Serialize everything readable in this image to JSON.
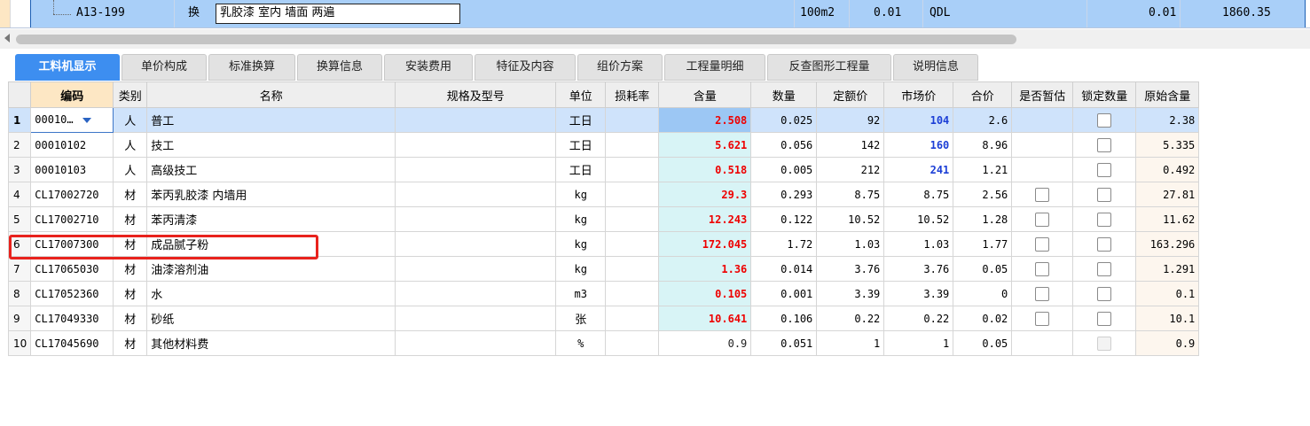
{
  "top_row": {
    "code": "A13-199",
    "type": "换",
    "name": "乳胶漆 室内 墙面 两遍",
    "unit": "100m2",
    "qty": "0.01",
    "expr": "QDL",
    "qty2": "0.01",
    "price": "1860.35"
  },
  "tabs": [
    "工料机显示",
    "单价构成",
    "标准换算",
    "换算信息",
    "安装费用",
    "特征及内容",
    "组价方案",
    "工程量明细",
    "反查图形工程量",
    "说明信息"
  ],
  "columns": {
    "code": "编码",
    "type": "类别",
    "name": "名称",
    "spec": "规格及型号",
    "unit": "单位",
    "loss": "损耗率",
    "content": "含量",
    "qty": "数量",
    "quota": "定额价",
    "market": "市场价",
    "total": "合价",
    "estimate": "是否暂估",
    "lock": "锁定数量",
    "orig": "原始含量"
  },
  "rows": [
    {
      "no": "1",
      "code": "00010…",
      "type": "人",
      "name": "普工",
      "unit": "工日",
      "content": "2.508",
      "qty": "0.025",
      "quota": "92",
      "market": "104",
      "total": "2.6",
      "orig": "2.38"
    },
    {
      "no": "2",
      "code": "00010102",
      "type": "人",
      "name": "技工",
      "unit": "工日",
      "content": "5.621",
      "qty": "0.056",
      "quota": "142",
      "market": "160",
      "total": "8.96",
      "orig": "5.335"
    },
    {
      "no": "3",
      "code": "00010103",
      "type": "人",
      "name": "高级技工",
      "unit": "工日",
      "content": "0.518",
      "qty": "0.005",
      "quota": "212",
      "market": "241",
      "total": "1.21",
      "orig": "0.492"
    },
    {
      "no": "4",
      "code": "CL17002720",
      "type": "材",
      "name": "苯丙乳胶漆 内墙用",
      "unit": "kg",
      "content": "29.3",
      "qty": "0.293",
      "quota": "8.75",
      "market": "8.75",
      "total": "2.56",
      "orig": "27.81"
    },
    {
      "no": "5",
      "code": "CL17002710",
      "type": "材",
      "name": "苯丙清漆",
      "unit": "kg",
      "content": "12.243",
      "qty": "0.122",
      "quota": "10.52",
      "market": "10.52",
      "total": "1.28",
      "orig": "11.62"
    },
    {
      "no": "6",
      "code": "CL17007300",
      "type": "材",
      "name": "成品腻子粉",
      "unit": "kg",
      "content": "172.045",
      "qty": "1.72",
      "quota": "1.03",
      "market": "1.03",
      "total": "1.77",
      "orig": "163.296"
    },
    {
      "no": "7",
      "code": "CL17065030",
      "type": "材",
      "name": "油漆溶剂油",
      "unit": "kg",
      "content": "1.36",
      "qty": "0.014",
      "quota": "3.76",
      "market": "3.76",
      "total": "0.05",
      "orig": "1.291"
    },
    {
      "no": "8",
      "code": "CL17052360",
      "type": "材",
      "name": "水",
      "unit": "m3",
      "content": "0.105",
      "qty": "0.001",
      "quota": "3.39",
      "market": "3.39",
      "total": "0",
      "orig": "0.1"
    },
    {
      "no": "9",
      "code": "CL17049330",
      "type": "材",
      "name": "砂纸",
      "unit": "张",
      "content": "10.641",
      "qty": "0.106",
      "quota": "0.22",
      "market": "0.22",
      "total": "0.02",
      "orig": "10.1"
    },
    {
      "no": "10",
      "code": "CL17045690",
      "type": "材",
      "name": "其他材料费",
      "unit": "%",
      "content": "0.9",
      "qty": "0.051",
      "quota": "1",
      "market": "1",
      "total": "0.05",
      "orig": "0.9"
    }
  ],
  "colors": {
    "accent": "#3d8ef0",
    "content_red": "#e00000",
    "market_blue": "#1c3fd6",
    "highlight": "#e8221d"
  }
}
